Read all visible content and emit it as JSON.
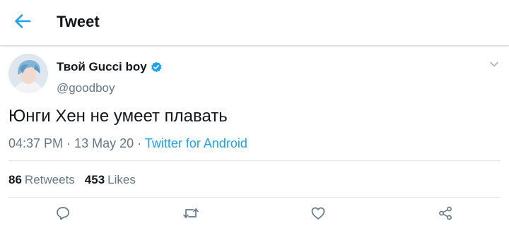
{
  "header": {
    "title": "Tweet",
    "back_icon": "arrow-left-icon",
    "accent_color": "#1da1f2"
  },
  "tweet": {
    "author": {
      "display_name": "Твой Gucci boy",
      "handle": "@goodboy",
      "verified": true,
      "verified_icon": "verified-badge-icon"
    },
    "text": "Юнги Хен не умеет плавать",
    "time": "04:37 PM",
    "date": "13 May 20",
    "separator": "·",
    "source": "Twitter for Android",
    "stats": {
      "retweets_count": "86",
      "retweets_label": "Retweets",
      "likes_count": "453",
      "likes_label": "Likes"
    },
    "actions": [
      "reply-icon",
      "retweet-icon",
      "like-icon",
      "share-icon"
    ]
  },
  "colors": {
    "text_primary": "#14171a",
    "text_secondary": "#657786",
    "link": "#1da1f2",
    "divider": "#e1e8ed"
  }
}
